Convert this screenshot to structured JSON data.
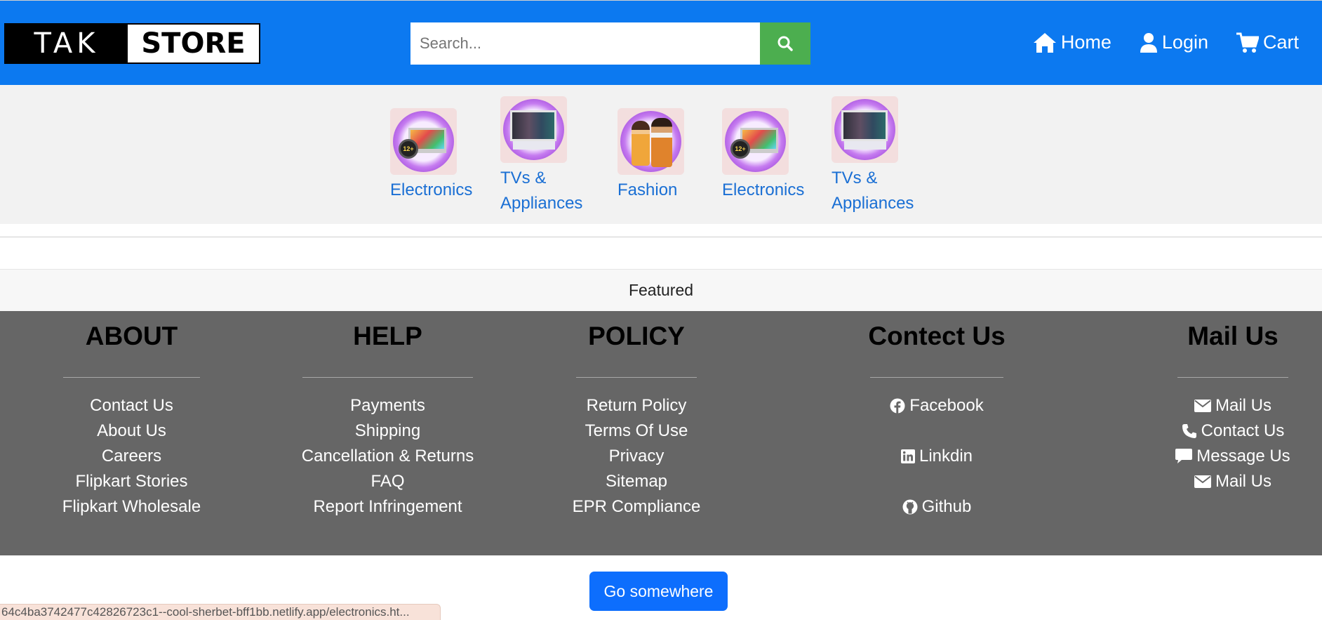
{
  "header": {
    "logo_left": "TAK",
    "logo_right": "STORE",
    "search_placeholder": "Search...",
    "nav": {
      "home": "Home",
      "login": "Login",
      "cart": "Cart"
    },
    "brand_color": "#0c79f0",
    "search_button_color": "#4cae4f"
  },
  "categories": [
    {
      "label_lines": [
        "Electronics"
      ],
      "image": "electronics-image"
    },
    {
      "label_lines": [
        "TVs &",
        "Appliances"
      ],
      "image": "tv-appliances-image"
    },
    {
      "label_lines": [
        "Fashion"
      ],
      "image": "fashion-image"
    },
    {
      "label_lines": [
        "Electronics"
      ],
      "image": "electronics-image"
    },
    {
      "label_lines": [
        "TVs &",
        "Appliances"
      ],
      "image": "tv-appliances-image"
    }
  ],
  "featured_label": "Featured",
  "footer": {
    "about": {
      "title": "ABOUT",
      "links": [
        "Contact Us",
        "About Us",
        "Careers",
        "Flipkart Stories",
        "Flipkart Wholesale"
      ]
    },
    "help": {
      "title": "HELP",
      "links": [
        "Payments",
        "Shipping",
        "Cancellation & Returns",
        "FAQ",
        "Report Infringement"
      ]
    },
    "policy": {
      "title": "POLICY",
      "links": [
        "Return Policy",
        "Terms Of Use",
        "Privacy",
        "Sitemap",
        "EPR Compliance"
      ]
    },
    "contact": {
      "title": "Contect Us",
      "links": [
        {
          "label": "Facebook",
          "icon": "facebook-icon"
        },
        {
          "label": "Linkdin",
          "icon": "linkedin-icon"
        },
        {
          "label": "Github",
          "icon": "github-icon"
        }
      ]
    },
    "mail": {
      "title": "Mail Us",
      "links": [
        {
          "label": "Mail Us",
          "icon": "envelope-icon"
        },
        {
          "label": "Contact Us",
          "icon": "phone-icon"
        },
        {
          "label": "Message Us",
          "icon": "message-icon"
        },
        {
          "label": "Mail Us",
          "icon": "envelope-icon"
        }
      ]
    },
    "background_color": "#666666"
  },
  "go_button": "Go somewhere",
  "status_url": "64c4ba3742477c42826723c1--cool-sherbet-bff1bb.netlify.app/electronics.ht..."
}
